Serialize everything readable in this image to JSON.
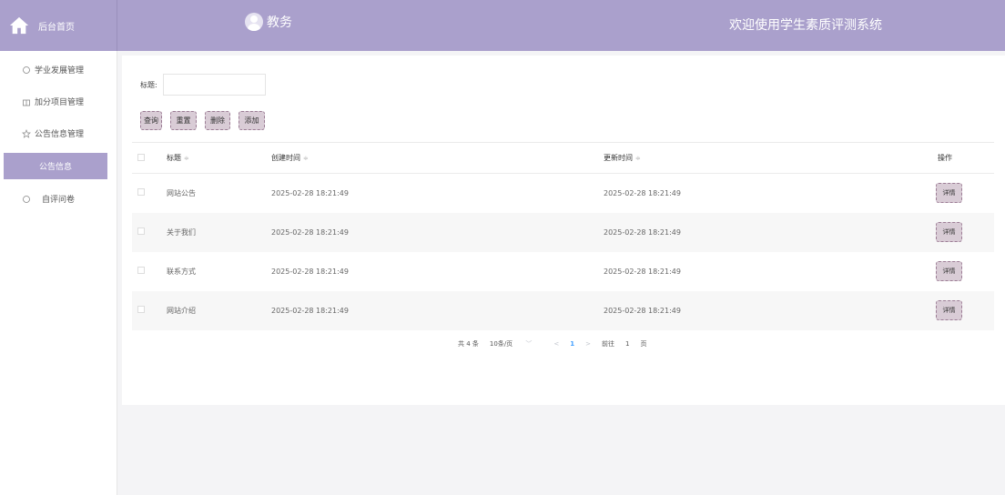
{
  "brand": {
    "label": "后台首页"
  },
  "header": {
    "role": "教务",
    "welcome": "欢迎使用学生素质评测系统"
  },
  "sidebar": {
    "items": [
      {
        "label": "学业发展管理"
      },
      {
        "label": "加分项目管理"
      },
      {
        "label": "公告信息管理"
      },
      {
        "label": "公告信息"
      },
      {
        "label": "自评问卷"
      }
    ]
  },
  "search": {
    "title_label": "标题:",
    "title_value": ""
  },
  "actions": {
    "query": "查询",
    "reset": "重置",
    "delete": "删除",
    "add": "添加"
  },
  "table": {
    "columns": {
      "title": "标题",
      "created": "创建时间",
      "updated": "更新时间",
      "ops": "操作"
    },
    "detail_label": "详情",
    "rows": [
      {
        "title": "网站公告",
        "created": "2025-02-28 18:21:49",
        "updated": "2025-02-28 18:21:49"
      },
      {
        "title": "关于我们",
        "created": "2025-02-28 18:21:49",
        "updated": "2025-02-28 18:21:49"
      },
      {
        "title": "联系方式",
        "created": "2025-02-28 18:21:49",
        "updated": "2025-02-28 18:21:49"
      },
      {
        "title": "网站介绍",
        "created": "2025-02-28 18:21:49",
        "updated": "2025-02-28 18:21:49"
      }
    ]
  },
  "pagination": {
    "total": "共 4 条",
    "page_size": "10条/页",
    "current": "1",
    "goto_label": "前往",
    "goto_value": "1",
    "page_unit": "页"
  },
  "colors": {
    "accent": "#aaa0cc",
    "button_bg": "#d9ccd6",
    "button_border": "#9c7d95",
    "link": "#409eff"
  }
}
